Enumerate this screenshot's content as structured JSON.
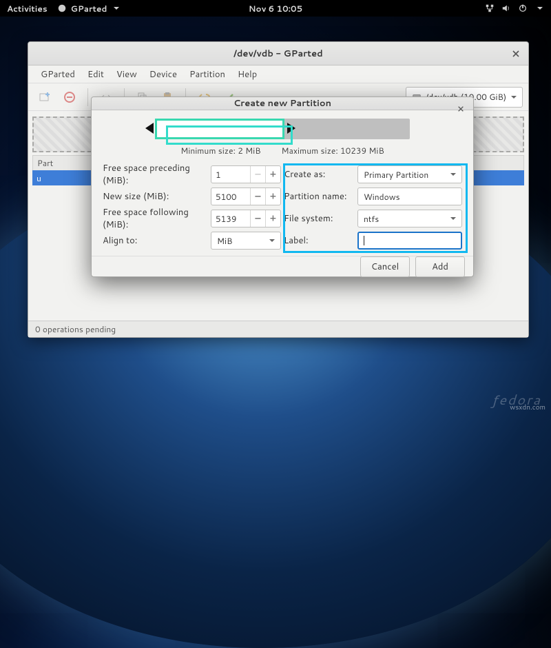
{
  "topbar": {
    "activities": "Activities",
    "app_name": "GParted",
    "clock": "Nov 6  10:05"
  },
  "window": {
    "title": "/dev/vdb - GParted",
    "menu": {
      "gparted": "GParted",
      "edit": "Edit",
      "view": "View",
      "device": "Device",
      "partition": "Partition",
      "help": "Help"
    },
    "device_selector": "/dev/vdb (10.00 GiB)",
    "parts_header": "Part",
    "parts_row": "u",
    "status": "0 operations pending"
  },
  "dialog": {
    "title": "Create new Partition",
    "min_size": "Minimum size: 2 MiB",
    "max_size": "Maximum size: 10239 MiB",
    "left": {
      "free_preceding_label": "Free space preceding (MiB):",
      "free_preceding_value": "1",
      "new_size_label": "New size (MiB):",
      "new_size_value": "5100",
      "free_following_label": "Free space following (MiB):",
      "free_following_value": "5139",
      "align_label": "Align to:",
      "align_value": "MiB"
    },
    "right": {
      "create_as_label": "Create as:",
      "create_as_value": "Primary Partition",
      "partition_name_label": "Partition name:",
      "partition_name_value": "Windows",
      "filesystem_label": "File system:",
      "filesystem_value": "ntfs",
      "label_label": "Label:",
      "label_value": ""
    },
    "cancel": "Cancel",
    "add": "Add"
  },
  "branding": {
    "distro": "fedora",
    "watermark": "wsxdn.com"
  }
}
